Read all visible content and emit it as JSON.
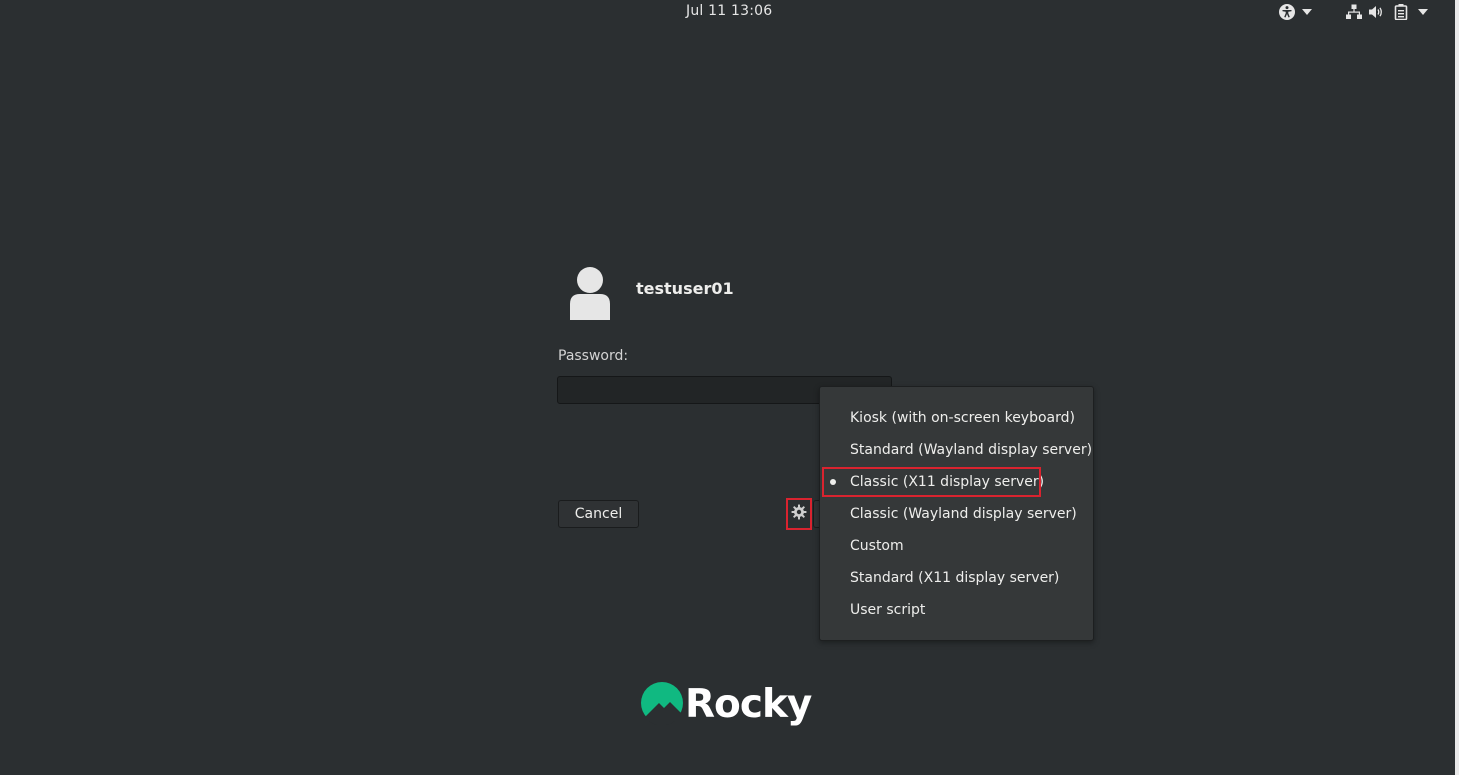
{
  "topbar": {
    "clock": "Jul 11  13:06",
    "icons": [
      "accessibility-icon",
      "chevron-down-icon",
      "network-icon",
      "volume-icon",
      "battery-icon",
      "chevron-down-icon"
    ]
  },
  "login": {
    "username": "testuser01",
    "password_label": "Password:",
    "password_value": "",
    "cancel_label": "Cancel",
    "session_button_icon": "gear-icon"
  },
  "session_menu": {
    "items": [
      {
        "label": "Kiosk (with on-screen keyboard)",
        "selected": false
      },
      {
        "label": "Standard (Wayland display server)",
        "selected": false
      },
      {
        "label": "Classic (X11 display server)",
        "selected": true
      },
      {
        "label": "Classic (Wayland display server)",
        "selected": false
      },
      {
        "label": "Custom",
        "selected": false
      },
      {
        "label": "Standard (X11 display server)",
        "selected": false
      },
      {
        "label": "User script",
        "selected": false
      }
    ]
  },
  "brand": {
    "logo_text": "Rocky",
    "logo_color": "#10b981"
  },
  "colors": {
    "background": "#2b2f31",
    "highlight": "#d9232f"
  }
}
